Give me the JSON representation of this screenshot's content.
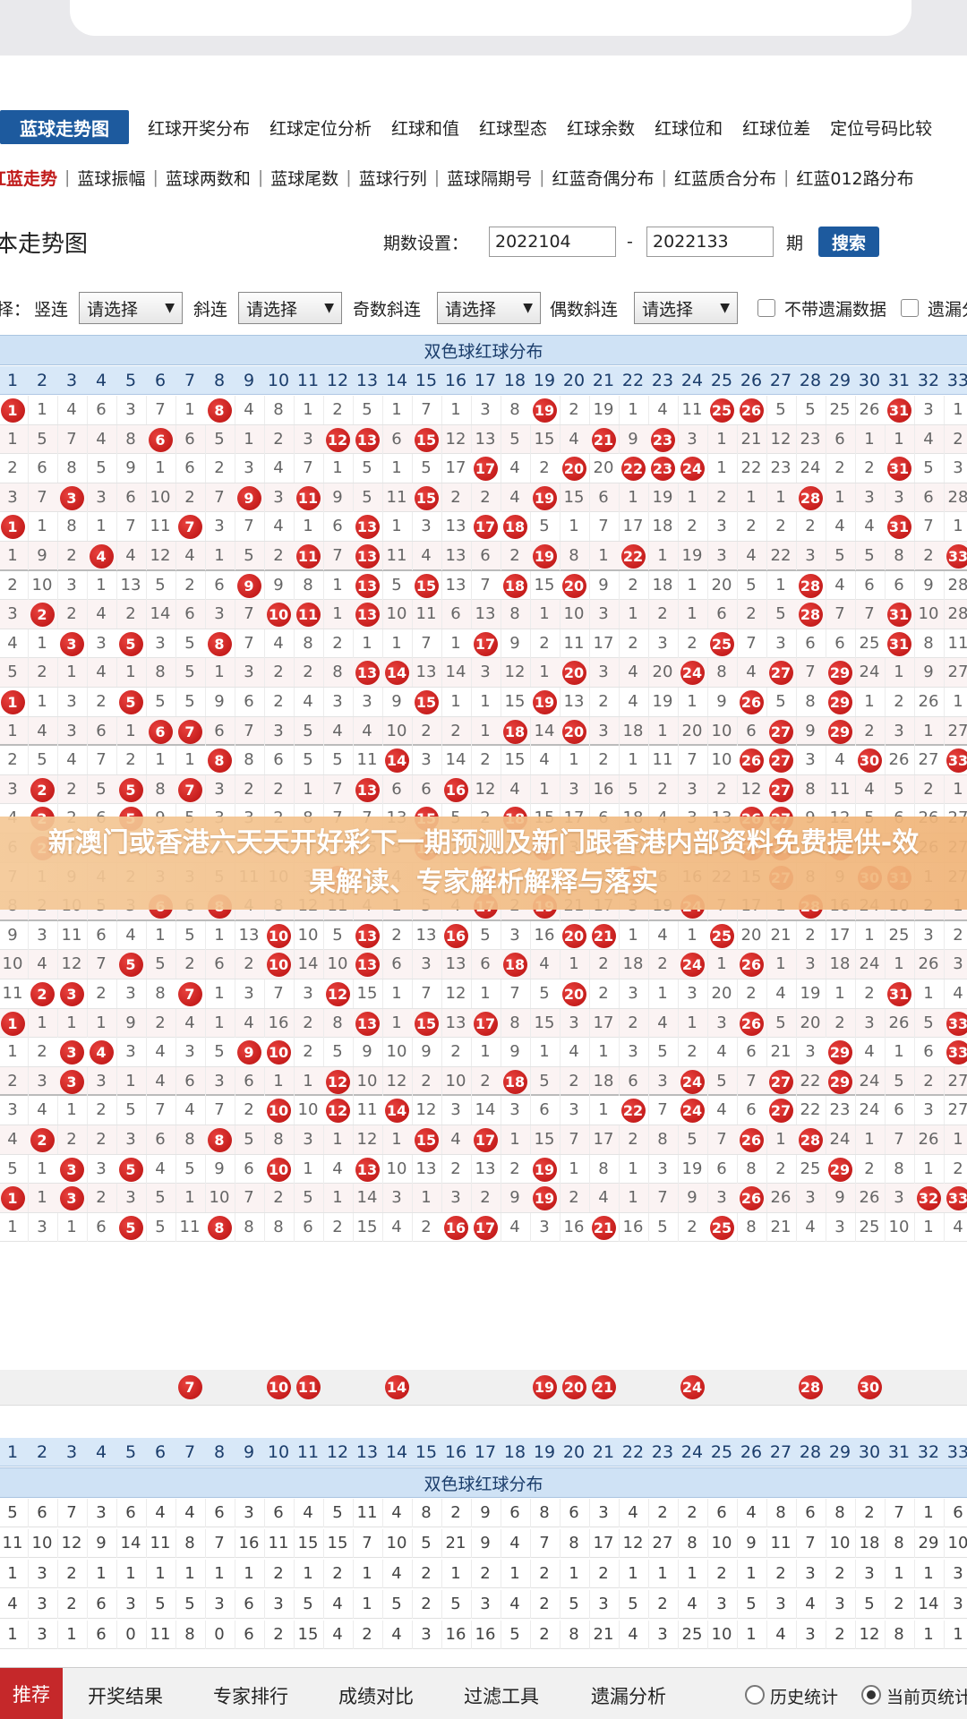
{
  "tabs_primary": {
    "active": "蓝球走势图",
    "items": [
      "红球开奖分布",
      "红球定位分析",
      "红球和值",
      "红球型态",
      "红球余数",
      "红球位和",
      "红球位差",
      "定位号码比较"
    ]
  },
  "tabs_secondary": {
    "active": "红蓝走势",
    "items": [
      "蓝球振幅",
      "蓝球两数和",
      "蓝球尾数",
      "蓝球行列",
      "蓝球隔期号",
      "红蓝奇偶分布",
      "红蓝质合分布",
      "红蓝012路分布"
    ]
  },
  "header": {
    "title": "本走势图",
    "period_label": "期数设置：",
    "period_from": "2022104",
    "dash": "-",
    "period_to": "2022133",
    "period_unit": "期",
    "search_label": "搜索"
  },
  "filters": {
    "prefix": "择：",
    "labels": [
      "竖连",
      "斜连",
      "奇数斜连",
      "偶数斜连"
    ],
    "select_value": "请选择",
    "checkbox1": "不带遗漏数据",
    "checkbox2": "遗漏分"
  },
  "grid": {
    "title": "双色球红球分布",
    "columns": [
      "1",
      "2",
      "3",
      "4",
      "5",
      "6",
      "7",
      "8",
      "9",
      "10",
      "11",
      "12",
      "13",
      "14",
      "15",
      "16",
      "17",
      "18",
      "19",
      "20",
      "21",
      "22",
      "23",
      "24",
      "25",
      "26",
      "27",
      "28",
      "29",
      "30",
      "31",
      "32",
      "33"
    ],
    "rows": [
      [
        "1",
        "4",
        "6",
        "3",
        "7",
        "1",
        "4",
        "8",
        "1",
        "2",
        "5",
        "1",
        "7",
        "1",
        "3",
        "8",
        "2",
        "19",
        "1",
        "4",
        "11",
        "5",
        "5",
        "25",
        "26",
        "3",
        "1",
        "2",
        "7",
        "31",
        "2",
        "6"
      ],
      [
        "1",
        "5",
        "7",
        "4",
        "8",
        "6",
        "5",
        "1",
        "2",
        "3",
        "6",
        "12",
        "13",
        "5",
        "15",
        "4",
        "9",
        "3",
        "1",
        "21",
        "12",
        "23",
        "6",
        "1",
        "1",
        "4",
        "2",
        "3",
        "8",
        "1",
        "2",
        "8"
      ],
      [
        "2",
        "6",
        "8",
        "5",
        "9",
        "1",
        "6",
        "2",
        "3",
        "4",
        "7",
        "1",
        "5",
        "1",
        "5",
        "17",
        "4",
        "2",
        "20",
        "1",
        "22",
        "23",
        "24",
        "2",
        "2",
        "5",
        "3",
        "4",
        "9",
        "31",
        "1",
        "2"
      ],
      [
        "3",
        "7",
        "3",
        "6",
        "10",
        "2",
        "7",
        "3",
        "9",
        "5",
        "11",
        "2",
        "2",
        "4",
        "15",
        "6",
        "1",
        "19",
        "1",
        "2",
        "1",
        "1",
        "1",
        "3",
        "3",
        "6",
        "28",
        "5",
        "10",
        "1",
        "5",
        "3"
      ],
      [
        "1",
        "8",
        "1",
        "7",
        "11",
        "3",
        "7",
        "4",
        "1",
        "6",
        "1",
        "3",
        "13",
        "5",
        "1",
        "7",
        "17",
        "18",
        "2",
        "3",
        "2",
        "2",
        "2",
        "4",
        "4",
        "7",
        "1",
        "6",
        "11",
        "31",
        "6",
        "10"
      ],
      [
        "1",
        "9",
        "2",
        "4",
        "12",
        "4",
        "1",
        "5",
        "2",
        "7",
        "11",
        "4",
        "13",
        "6",
        "2",
        "8",
        "1",
        "1",
        "19",
        "3",
        "4",
        "22",
        "3",
        "5",
        "5",
        "8",
        "2",
        "7",
        "12",
        "1",
        "7",
        "33"
      ],
      [
        "2",
        "10",
        "3",
        "1",
        "13",
        "5",
        "2",
        "6",
        "9",
        "8",
        "1",
        "5",
        "13",
        "7",
        "15",
        "9",
        "2",
        "18",
        "1",
        "20",
        "5",
        "1",
        "4",
        "6",
        "6",
        "9",
        "28",
        "8",
        "13",
        "2",
        "8",
        "1"
      ],
      [
        "3",
        "2",
        "4",
        "2",
        "14",
        "6",
        "3",
        "7",
        "1",
        "10",
        "11",
        "6",
        "13",
        "8",
        "1",
        "10",
        "3",
        "1",
        "2",
        "1",
        "6",
        "2",
        "5",
        "7",
        "7",
        "10",
        "28",
        "9",
        "13",
        "31",
        "9",
        "2"
      ],
      [
        "4",
        "1",
        "3",
        "3",
        "5",
        "7",
        "4",
        "8",
        "2",
        "1",
        "1",
        "7",
        "1",
        "9",
        "2",
        "11",
        "17",
        "2",
        "3",
        "2",
        "7",
        "3",
        "6",
        "6",
        "25",
        "8",
        "11",
        "1",
        "10",
        "31",
        "10",
        "3"
      ],
      [
        "5",
        "2",
        "1",
        "4",
        "1",
        "8",
        "5",
        "1",
        "3",
        "2",
        "2",
        "8",
        "13",
        "14",
        "3",
        "12",
        "1",
        "3",
        "4",
        "20",
        "8",
        "4",
        "7",
        "24",
        "1",
        "9",
        "27",
        "2",
        "29",
        "16",
        "1",
        "11"
      ],
      [
        "1",
        "3",
        "2",
        "5",
        "5",
        "9",
        "6",
        "2",
        "4",
        "3",
        "3",
        "9",
        "1",
        "1",
        "15",
        "13",
        "2",
        "4",
        "19",
        "1",
        "9",
        "5",
        "8",
        "1",
        "2",
        "26",
        "1",
        "3",
        "29",
        "17",
        "2",
        "12"
      ],
      [
        "1",
        "4",
        "3",
        "6",
        "1",
        "6",
        "7",
        "3",
        "5",
        "4",
        "4",
        "10",
        "2",
        "2",
        "1",
        "14",
        "3",
        "18",
        "1",
        "20",
        "10",
        "6",
        "9",
        "2",
        "3",
        "1",
        "27",
        "4",
        "29",
        "18",
        "3",
        "13"
      ],
      [
        "2",
        "5",
        "4",
        "7",
        "2",
        "1",
        "1",
        "8",
        "6",
        "5",
        "5",
        "11",
        "3",
        "14",
        "2",
        "15",
        "4",
        "1",
        "2",
        "1",
        "11",
        "7",
        "10",
        "3",
        "4",
        "26",
        "27",
        "5",
        "1",
        "30",
        "4",
        "33"
      ],
      [
        "3",
        "2",
        "5",
        "8",
        "3",
        "2",
        "2",
        "1",
        "7",
        "6",
        "6",
        "12",
        "4",
        "1",
        "3",
        "16",
        "5",
        "2",
        "3",
        "2",
        "12",
        "8",
        "11",
        "4",
        "5",
        "2",
        "1",
        "6",
        "2",
        "1",
        "5",
        "1"
      ],
      [
        "4",
        "2",
        "6",
        "9",
        "5",
        "3",
        "3",
        "2",
        "8",
        "7",
        "7",
        "13",
        "5",
        "2",
        "15",
        "17",
        "6",
        "18",
        "4",
        "3",
        "13",
        "9",
        "12",
        "5",
        "6",
        "26",
        "27",
        "7",
        "3",
        "2",
        "6",
        "2"
      ],
      [
        "6",
        "2",
        "8",
        "3",
        "1",
        "2",
        "2",
        "4",
        "10",
        "9",
        "2",
        "15",
        "3",
        "2",
        "15",
        "19",
        "3",
        "1",
        "19",
        "5",
        "15",
        "11",
        "14",
        "7",
        "8",
        "26",
        "27",
        "9",
        "29",
        "4",
        "8",
        "3"
      ],
      [
        "7",
        "1",
        "9",
        "4",
        "2",
        "3",
        "3",
        "5",
        "11",
        "10",
        "3",
        "12",
        "4",
        "3",
        "1",
        "20",
        "17",
        "2",
        "1",
        "6",
        "16",
        "22",
        "15",
        "8",
        "9",
        "1",
        "27",
        "4",
        "1",
        "30",
        "31",
        "19"
      ],
      [
        "8",
        "2",
        "10",
        "5",
        "3",
        "6",
        "4",
        "8",
        "12",
        "11",
        "4",
        "1",
        "5",
        "4",
        "2",
        "21",
        "17",
        "3",
        "19",
        "7",
        "17",
        "1",
        "16",
        "24",
        "10",
        "2",
        "1",
        "28",
        "2",
        "1",
        "1",
        "20"
      ],
      [
        "9",
        "3",
        "11",
        "6",
        "4",
        "1",
        "5",
        "1",
        "13",
        "10",
        "5",
        "2",
        "13",
        "5",
        "3",
        "16",
        "1",
        "4",
        "1",
        "20",
        "21",
        "2",
        "17",
        "1",
        "25",
        "3",
        "2",
        "1",
        "3",
        "2",
        "2",
        "21"
      ],
      [
        "10",
        "4",
        "12",
        "7",
        "5",
        "2",
        "6",
        "2",
        "14",
        "10",
        "6",
        "3",
        "13",
        "6",
        "4",
        "1",
        "2",
        "18",
        "2",
        "1",
        "1",
        "3",
        "18",
        "24",
        "1",
        "26",
        "3",
        "2",
        "4",
        "3",
        "3",
        "22"
      ],
      [
        "11",
        "2",
        "3",
        "8",
        "1",
        "3",
        "7",
        "3",
        "15",
        "1",
        "7",
        "12",
        "1",
        "7",
        "5",
        "2",
        "3",
        "1",
        "3",
        "20",
        "2",
        "4",
        "19",
        "1",
        "2",
        "1",
        "4",
        "3",
        "5",
        "31",
        "4",
        "23"
      ],
      [
        "1",
        "1",
        "1",
        "9",
        "2",
        "4",
        "1",
        "4",
        "16",
        "2",
        "8",
        "1",
        "13",
        "8",
        "15",
        "3",
        "17",
        "2",
        "4",
        "1",
        "3",
        "5",
        "20",
        "2",
        "3",
        "26",
        "5",
        "4",
        "6",
        "1",
        "5",
        "33"
      ],
      [
        "1",
        "2",
        "3",
        "4",
        "3",
        "5",
        "2",
        "5",
        "9",
        "10",
        "9",
        "2",
        "1",
        "9",
        "1",
        "4",
        "1",
        "3",
        "5",
        "2",
        "4",
        "6",
        "21",
        "3",
        "4",
        "1",
        "6",
        "5",
        "29",
        "2",
        "6",
        "33"
      ],
      [
        "2",
        "3",
        "3",
        "1",
        "4",
        "6",
        "3",
        "6",
        "1",
        "1",
        "10",
        "12",
        "2",
        "10",
        "2",
        "5",
        "2",
        "18",
        "6",
        "3",
        "5",
        "7",
        "22",
        "24",
        "5",
        "2",
        "27",
        "6",
        "29",
        "3",
        "7",
        "26"
      ],
      [
        "3",
        "4",
        "1",
        "2",
        "5",
        "7",
        "4",
        "7",
        "2",
        "10",
        "11",
        "12",
        "3",
        "14",
        "3",
        "6",
        "3",
        "1",
        "7",
        "4",
        "6",
        "22",
        "23",
        "24",
        "6",
        "3",
        "27",
        "7",
        "1",
        "4",
        "8",
        "27"
      ],
      [
        "4",
        "2",
        "2",
        "3",
        "6",
        "8",
        "5",
        "8",
        "3",
        "1",
        "12",
        "1",
        "4",
        "1",
        "15",
        "7",
        "17",
        "2",
        "8",
        "5",
        "7",
        "1",
        "24",
        "1",
        "7",
        "26",
        "1",
        "28",
        "2",
        "5",
        "9",
        "28"
      ],
      [
        "5",
        "1",
        "3",
        "4",
        "5",
        "9",
        "6",
        "1",
        "4",
        "10",
        "13",
        "2",
        "13",
        "2",
        "1",
        "8",
        "1",
        "3",
        "19",
        "6",
        "8",
        "2",
        "25",
        "2",
        "8",
        "1",
        "2",
        "1",
        "29",
        "10",
        "6",
        "29"
      ],
      [
        "1",
        "2",
        "3",
        "5",
        "1",
        "10",
        "7",
        "2",
        "5",
        "1",
        "14",
        "3",
        "1",
        "3",
        "2",
        "9",
        "2",
        "4",
        "1",
        "7",
        "9",
        "3",
        "26",
        "3",
        "9",
        "26",
        "3",
        "2",
        "1",
        "11",
        "32",
        "33"
      ],
      [
        "1",
        "3",
        "1",
        "6",
        "5",
        "11",
        "8",
        "8",
        "6",
        "2",
        "15",
        "4",
        "2",
        "4",
        "3",
        "16",
        "16",
        "5",
        "2",
        "8",
        "21",
        "4",
        "3",
        "25",
        "10",
        "1",
        "4",
        "3",
        "2",
        "12",
        "1",
        "1"
      ]
    ],
    "hits": [
      [
        1,
        8,
        19,
        25,
        26,
        31
      ],
      [
        6,
        12,
        13,
        15,
        21,
        23
      ],
      [
        17,
        20,
        22,
        23,
        24,
        31
      ],
      [
        3,
        9,
        11,
        15,
        19,
        28
      ],
      [
        1,
        7,
        13,
        17,
        18,
        31
      ],
      [
        4,
        11,
        13,
        19,
        22,
        33
      ],
      [
        9,
        13,
        15,
        18,
        20,
        28
      ],
      [
        2,
        10,
        11,
        13,
        28,
        31
      ],
      [
        3,
        5,
        8,
        17,
        25,
        31
      ],
      [
        13,
        14,
        20,
        24,
        27,
        29
      ],
      [
        1,
        5,
        15,
        19,
        26,
        29
      ],
      [
        6,
        7,
        18,
        20,
        27,
        29
      ],
      [
        8,
        14,
        26,
        27,
        30,
        33
      ],
      [
        2,
        5,
        7,
        13,
        16,
        27
      ],
      [
        2,
        5,
        15,
        18,
        26,
        27
      ],
      [
        2,
        15,
        19,
        26,
        27,
        29
      ],
      [
        12,
        17,
        22,
        27,
        30,
        31
      ],
      [
        6,
        8,
        17,
        19,
        24,
        28
      ],
      [
        10,
        13,
        16,
        20,
        21,
        25
      ],
      [
        5,
        10,
        13,
        18,
        24,
        26
      ],
      [
        2,
        3,
        7,
        12,
        20,
        31
      ],
      [
        1,
        13,
        15,
        17,
        26,
        33
      ],
      [
        3,
        4,
        9,
        10,
        29,
        33
      ],
      [
        3,
        12,
        18,
        24,
        27,
        29
      ],
      [
        10,
        12,
        14,
        22,
        24,
        27
      ],
      [
        2,
        8,
        15,
        17,
        26,
        28
      ],
      [
        3,
        5,
        10,
        13,
        19,
        29
      ],
      [
        1,
        3,
        19,
        26,
        32,
        33
      ],
      [
        5,
        8,
        16,
        17,
        21,
        25
      ]
    ],
    "summary_hits": [
      "7",
      "10",
      "11",
      "14",
      "19",
      "20",
      "21",
      "24",
      "28",
      "30"
    ],
    "stats_title": "双色球红球分布",
    "stats": [
      [
        "5",
        "6",
        "7",
        "3",
        "6",
        "4",
        "4",
        "6",
        "3",
        "6",
        "4",
        "5",
        "11",
        "4",
        "8",
        "2",
        "9",
        "6",
        "8",
        "6",
        "3",
        "4",
        "2",
        "2",
        "6",
        "4",
        "8",
        "6",
        "8",
        "2",
        "7",
        "1",
        "6"
      ],
      [
        "11",
        "10",
        "12",
        "9",
        "14",
        "11",
        "8",
        "7",
        "16",
        "11",
        "15",
        "15",
        "7",
        "10",
        "5",
        "21",
        "9",
        "4",
        "7",
        "8",
        "17",
        "12",
        "27",
        "8",
        "10",
        "9",
        "11",
        "7",
        "10",
        "18",
        "8",
        "29",
        "10"
      ],
      [
        "1",
        "3",
        "2",
        "1",
        "1",
        "1",
        "1",
        "1",
        "1",
        "2",
        "1",
        "2",
        "1",
        "4",
        "2",
        "1",
        "2",
        "1",
        "2",
        "1",
        "2",
        "1",
        "1",
        "1",
        "2",
        "1",
        "2",
        "3",
        "2",
        "3",
        "1",
        "1",
        "3"
      ],
      [
        "4",
        "3",
        "2",
        "6",
        "3",
        "5",
        "5",
        "3",
        "6",
        "3",
        "5",
        "4",
        "1",
        "5",
        "2",
        "5",
        "3",
        "4",
        "2",
        "5",
        "3",
        "5",
        "2",
        "4",
        "3",
        "5",
        "3",
        "4",
        "3",
        "5",
        "2",
        "14",
        "3"
      ],
      [
        "1",
        "3",
        "1",
        "6",
        "0",
        "11",
        "8",
        "0",
        "6",
        "2",
        "15",
        "4",
        "2",
        "4",
        "3",
        "16",
        "16",
        "5",
        "2",
        "8",
        "21",
        "4",
        "3",
        "25",
        "10",
        "1",
        "4",
        "3",
        "2",
        "12",
        "8",
        "1",
        "1"
      ]
    ]
  },
  "banner": {
    "text": "新澳门或香港六天天开好彩下一期预测及新门跟香港内部资料免费提供-效果解读、专家解析解释与落实"
  },
  "bottom_bar": {
    "recommend": "推荐",
    "items": [
      "开奖结果",
      "专家排行",
      "成绩对比",
      "过滤工具",
      "遗漏分析"
    ],
    "radio1": "历史统计",
    "radio2": "当前页统计"
  }
}
